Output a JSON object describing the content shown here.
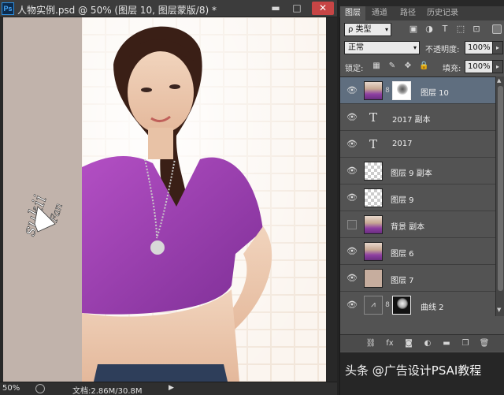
{
  "window": {
    "app_icon": "Ps",
    "title": "人物实例.psd @ 50% (图层 10, 图层蒙版/8) *",
    "minimize_glyph": "▬",
    "maximize_glyph": "□",
    "close_glyph": "✕"
  },
  "status": {
    "zoom": "50%",
    "doc_info": "文档:2.86M/30.8M",
    "arrow_glyph": "▶"
  },
  "canvas": {
    "signature_text": "sukii",
    "signature_sub": "Fan"
  },
  "panel": {
    "tabs": [
      {
        "label": "图层",
        "active": true
      },
      {
        "label": "通道",
        "active": false
      },
      {
        "label": "路径",
        "active": false
      },
      {
        "label": "历史记录",
        "active": false
      }
    ],
    "filter": {
      "kind_label": "ρ 类型",
      "icons": [
        "image-filter-icon",
        "adjustment-filter-icon",
        "type-filter-icon",
        "shape-filter-icon",
        "smart-object-filter-icon"
      ],
      "icon_glyphs": [
        "▣",
        "◑",
        "T",
        "⬚",
        "⊡"
      ]
    },
    "blend_mode": "正常",
    "opacity_label": "不透明度:",
    "opacity_value": "100%",
    "lock_label": "锁定:",
    "fill_label": "填充:",
    "fill_value": "100%",
    "lock_glyphs": [
      "▦",
      "✎",
      "✥",
      "🔒"
    ],
    "layers": [
      {
        "name": "图层 10",
        "type": "photo-with-mask",
        "visible": true,
        "selected": true
      },
      {
        "name": "2017 副本",
        "type": "text",
        "visible": true,
        "selected": false
      },
      {
        "name": "2017",
        "type": "text",
        "visible": true,
        "selected": false
      },
      {
        "name": "图层 9 副本",
        "type": "transparent",
        "visible": true,
        "selected": false
      },
      {
        "name": "图层 9",
        "type": "transparent",
        "visible": true,
        "selected": false
      },
      {
        "name": "背景 副本",
        "type": "photo",
        "visible": false,
        "selected": false
      },
      {
        "name": "图层 6",
        "type": "photo",
        "visible": true,
        "selected": false
      },
      {
        "name": "图层 7",
        "type": "fill",
        "visible": true,
        "selected": false
      },
      {
        "name": "曲线 2",
        "type": "adjustment",
        "visible": true,
        "selected": false
      }
    ],
    "eye_glyph": "👁",
    "text_glyph": "T",
    "chain_glyph": "8",
    "adjust_glyph": "⩘",
    "footer_icons": [
      {
        "name": "link-layers-icon",
        "glyph": "⛓"
      },
      {
        "name": "layer-style-icon",
        "glyph": "fx"
      },
      {
        "name": "add-mask-icon",
        "glyph": "◙"
      },
      {
        "name": "adjustment-layer-icon",
        "glyph": "◐"
      },
      {
        "name": "new-group-icon",
        "glyph": "▬"
      },
      {
        "name": "new-layer-icon",
        "glyph": "❐"
      },
      {
        "name": "delete-layer-icon",
        "glyph": "🗑"
      }
    ]
  },
  "watermark": "头条 @广告设计PSAI教程"
}
